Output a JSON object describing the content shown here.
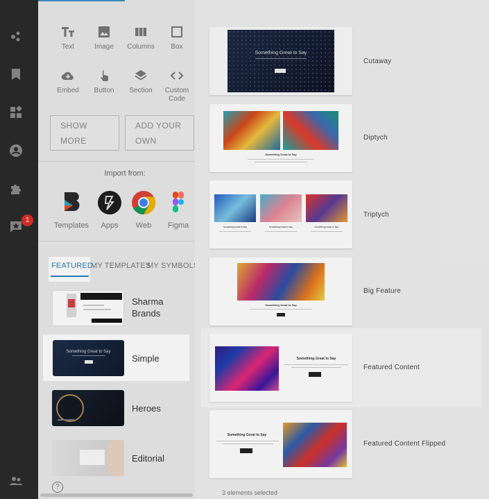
{
  "rail": {
    "icons": [
      "layers-icon",
      "network-icon",
      "bookmark-icon",
      "apps-icon",
      "account-icon",
      "plugin-icon",
      "feedback-icon",
      "team-icon"
    ],
    "badge": "1"
  },
  "tools": {
    "text": "Text",
    "image": "Image",
    "columns": "Columns",
    "box": "Box",
    "embed": "Embed",
    "button": "Button",
    "section": "Section",
    "custom_code_line1": "Custom",
    "custom_code_line2": "Code"
  },
  "buttons": {
    "show_more": "SHOW MORE",
    "add_own_line1": "ADD YOUR",
    "add_own_line2": "OWN"
  },
  "import": {
    "title": "Import from:",
    "sources": [
      "Templates",
      "Apps",
      "Web",
      "Figma"
    ]
  },
  "tabs": {
    "featured": "FEATURED",
    "my_templates": "MY TEMPLATES",
    "my_symbols": "MY SYMBOLS"
  },
  "templates": {
    "sharma_line1": "Sharma",
    "sharma_line2": "Brands",
    "simple": "Simple",
    "heroes": "Heroes",
    "editorial": "Editorial"
  },
  "layouts": {
    "headline": "Something Great to Say",
    "names": [
      "Cutaway",
      "Diptych",
      "Triptych",
      "Big Feature",
      "Featured Content",
      "Featured Content Flipped"
    ]
  },
  "status": {
    "selection": "3 elements selected",
    "help": "?"
  },
  "colors": {
    "accent": "#2a7fb8",
    "badge": "#d9302a"
  }
}
